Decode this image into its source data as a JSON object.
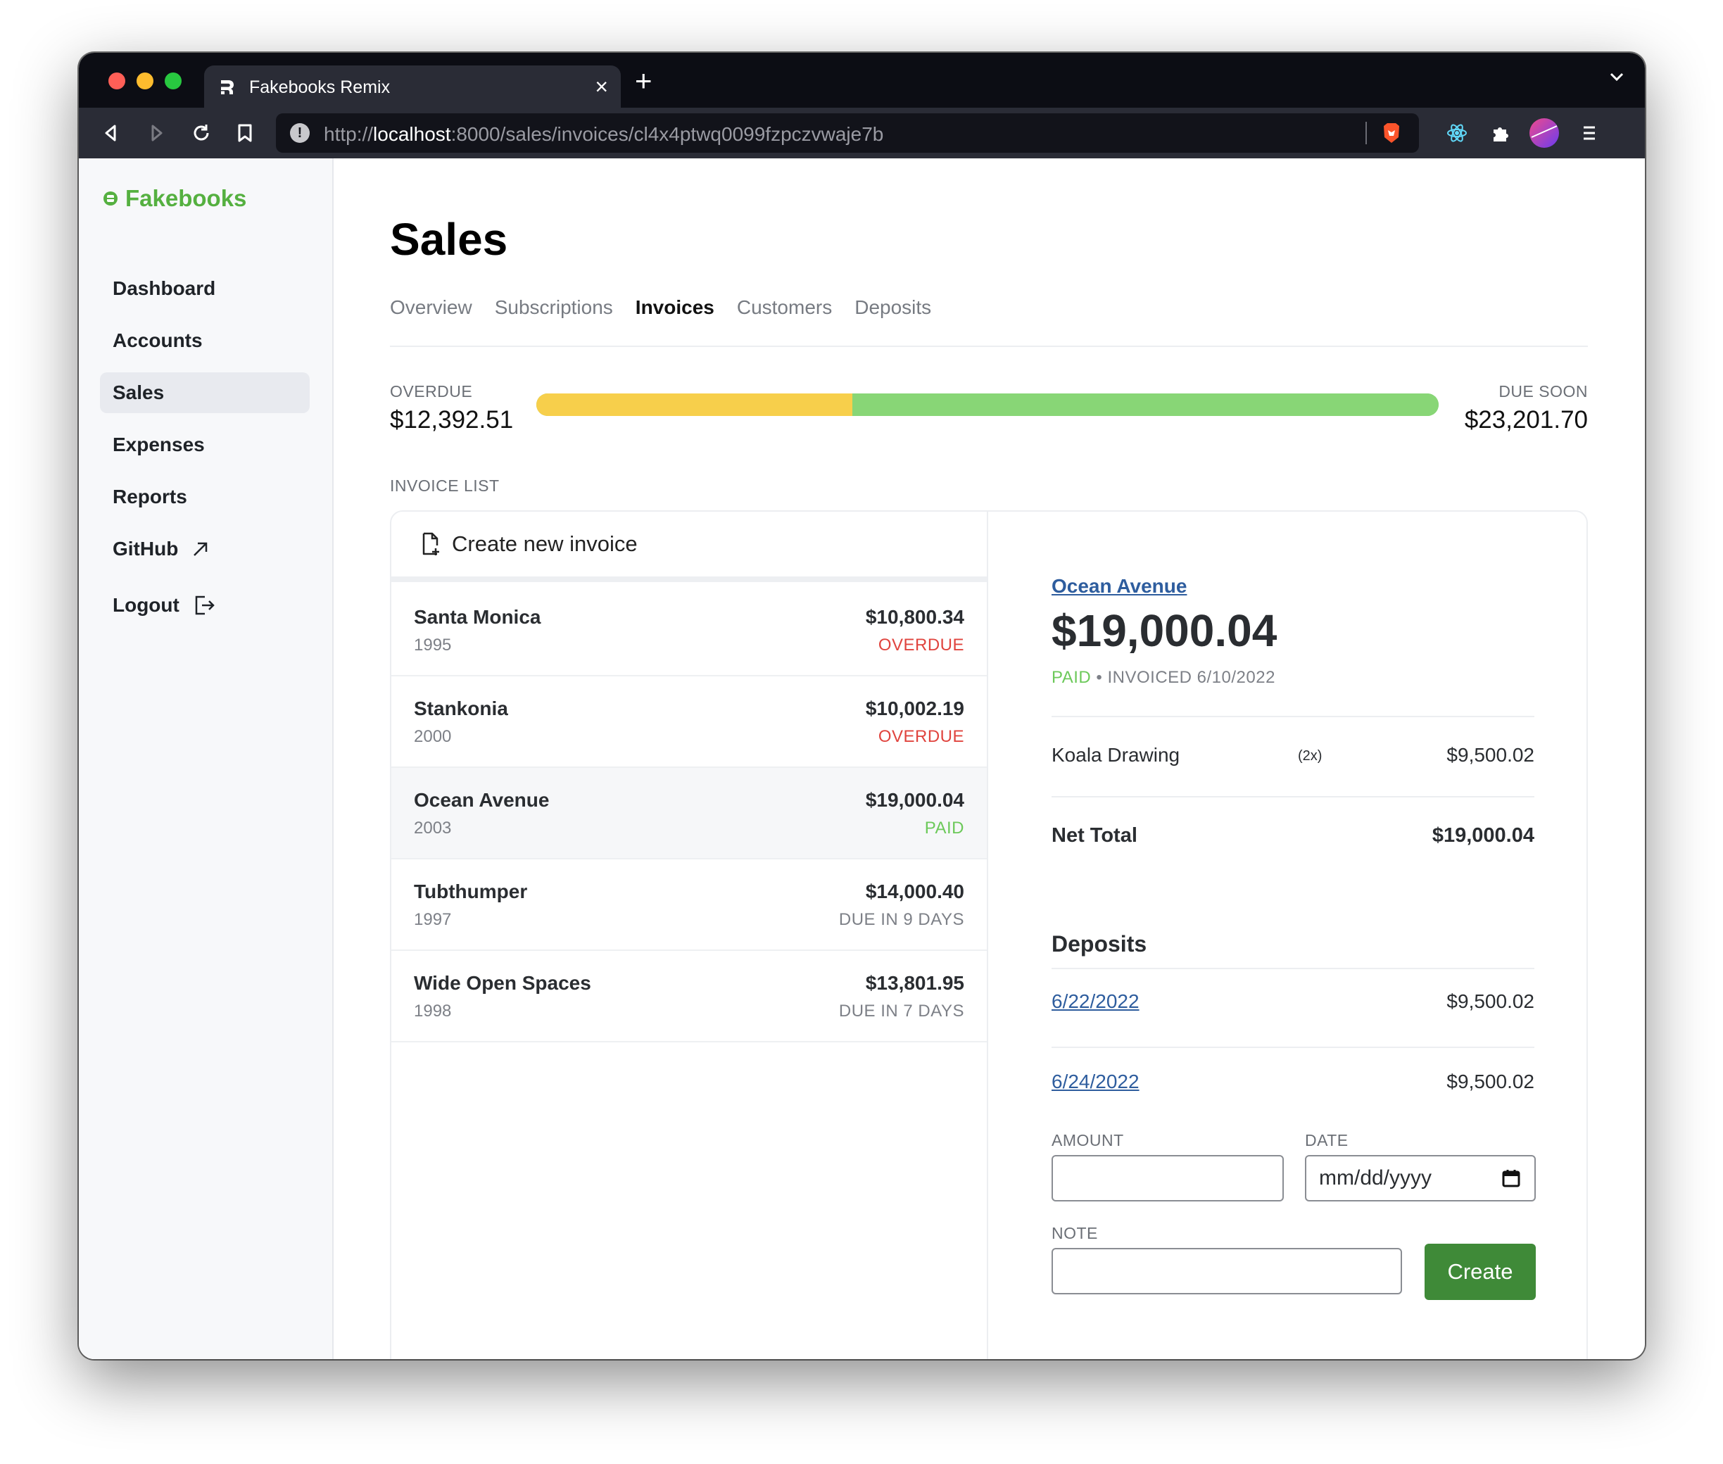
{
  "browser": {
    "tab_title": "Fakebooks Remix",
    "url_prefix": "http://",
    "url_host": "localhost",
    "url_rest": ":8000/sales/invoices/cl4x4ptwq0099fzpczvwaje7b"
  },
  "sidebar": {
    "logo": "Fakebooks",
    "items": [
      {
        "label": "Dashboard"
      },
      {
        "label": "Accounts"
      },
      {
        "label": "Sales"
      },
      {
        "label": "Expenses"
      },
      {
        "label": "Reports"
      },
      {
        "label": "GitHub"
      },
      {
        "label": "Logout"
      }
    ],
    "active": "Sales"
  },
  "main": {
    "title": "Sales",
    "tabs": [
      {
        "label": "Overview"
      },
      {
        "label": "Subscriptions"
      },
      {
        "label": "Invoices"
      },
      {
        "label": "Customers"
      },
      {
        "label": "Deposits"
      }
    ],
    "active_tab": "Invoices",
    "overdue_label": "OVERDUE",
    "overdue_amount": "$12,392.51",
    "due_soon_label": "DUE SOON",
    "due_soon_amount": "$23,201.70",
    "overdue_fraction": 0.35,
    "invoice_list_label": "INVOICE LIST",
    "create_invoice_label": "Create new invoice",
    "invoices": [
      {
        "name": "Santa Monica",
        "year": "1995",
        "amount": "$10,800.34",
        "status": "OVERDUE"
      },
      {
        "name": "Stankonia",
        "year": "2000",
        "amount": "$10,002.19",
        "status": "OVERDUE"
      },
      {
        "name": "Ocean Avenue",
        "year": "2003",
        "amount": "$19,000.04",
        "status": "PAID"
      },
      {
        "name": "Tubthumper",
        "year": "1997",
        "amount": "$14,000.40",
        "status": "DUE IN 9 DAYS"
      },
      {
        "name": "Wide Open Spaces",
        "year": "1998",
        "amount": "$13,801.95",
        "status": "DUE IN 7 DAYS"
      }
    ],
    "selected_invoice": "Ocean Avenue"
  },
  "detail": {
    "customer": "Ocean Avenue",
    "amount": "$19,000.04",
    "status": "PAID",
    "status_sep": " • ",
    "invoiced": "INVOICED 6/10/2022",
    "line_item": {
      "name": "Koala Drawing",
      "qty": "(2x)",
      "amount": "$9,500.02"
    },
    "net_total_label": "Net Total",
    "net_total": "$19,000.04",
    "deposits_title": "Deposits",
    "deposits": [
      {
        "date": "6/22/2022",
        "amount": "$9,500.02"
      },
      {
        "date": "6/24/2022",
        "amount": "$9,500.02"
      }
    ],
    "form": {
      "amount_label": "AMOUNT",
      "date_label": "DATE",
      "date_placeholder": "mm/dd/yyyy",
      "note_label": "NOTE",
      "create_label": "Create"
    }
  },
  "colors": {
    "brand": "#55b040",
    "overdue_bar": "#f7cf4b",
    "due_soon_bar": "#88d676",
    "overdue_text": "#e0443e",
    "paid_text": "#6cc95a",
    "link": "#2e5d9e",
    "create_button": "#3f8a38"
  }
}
